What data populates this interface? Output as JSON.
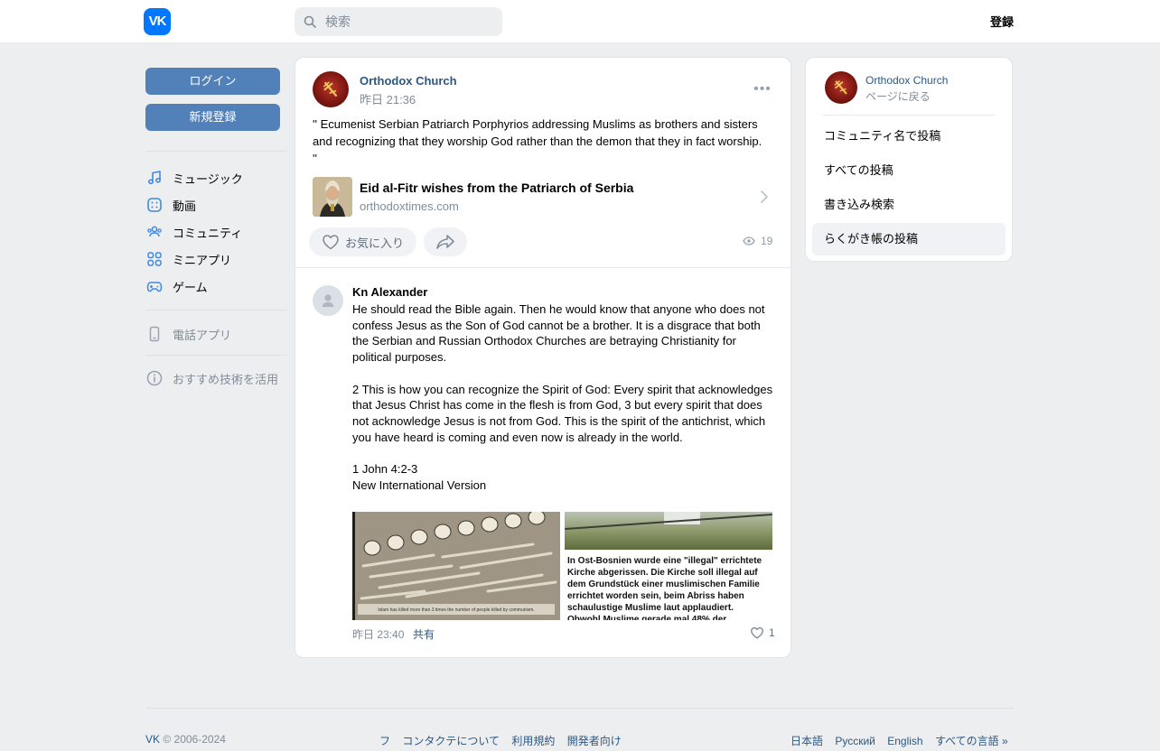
{
  "header": {
    "logo_text": "VK",
    "search_placeholder": "検索",
    "register_label": "登録"
  },
  "sidebar": {
    "login_label": "ログイン",
    "signup_label": "新規登録",
    "items": [
      {
        "label": "ミュージック",
        "icon": "music-icon"
      },
      {
        "label": "動画",
        "icon": "video-icon"
      },
      {
        "label": "コミュニティ",
        "icon": "community-icon"
      },
      {
        "label": "ミニアプリ",
        "icon": "mini-apps-icon"
      },
      {
        "label": "ゲーム",
        "icon": "gamepad-icon"
      }
    ],
    "phone_app_label": "電話アプリ",
    "recommend_label": "おすすめ技術を活用"
  },
  "post": {
    "author": "Orthodox Church",
    "time": "昨日 21:36",
    "text": "'' Ecumenist Serbian Patriarch Porphyrios addressing Muslims as brothers and sisters and recognizing that they worship God rather than the demon that they in fact worship. ''",
    "link_title": "Eid al-Fitr wishes from the Patriarch of Serbia",
    "link_domain": "orthodoxtimes.com",
    "like_label": "お気に入り",
    "views": "19"
  },
  "comment": {
    "author": "Kn Alexander",
    "paragraphs": [
      "He should read the Bible again. Then he would know that anyone who does not confess Jesus as the Son of God cannot be a brother. It is a disgrace that both the Serbian and Russian Orthodox Churches are betraying Christianity for political purposes.",
      "2 This is how you can recognize the Spirit of God: Every spirit that acknowledges that Jesus Christ has come in the flesh is from God, 3 but every spirit that does not acknowledge Jesus is not from God. This is the spirit of the antichrist, which you have heard is coming and even now is already in the world.",
      "1 John 4:2-3\nNew International Version"
    ],
    "image1_caption": "Islam has killed more than 3 times the number of people killed by communism.",
    "image2_caption": "In Ost-Bosnien wurde eine \"illegal\" errichtete Kirche abgerissen. Die Kirche soll illegal auf dem Grundstück einer muslimischen Familie errichtet worden sein, beim Abriss haben schaulustige Muslime laut applaudiert. Obwohl Muslime gerade mal 48% der",
    "time": "昨日 23:40",
    "share_label": "共有",
    "likes": "1"
  },
  "right_column": {
    "name": "Orthodox Church",
    "back_label": "ページに戻る",
    "items": [
      {
        "label": "コミュニティ名で投稿",
        "active": false
      },
      {
        "label": "すべての投稿",
        "active": false
      },
      {
        "label": "書き込み検索",
        "active": false
      },
      {
        "label": "らくがき帳の投稿",
        "active": true
      }
    ]
  },
  "footer": {
    "copyright_brand": "VK",
    "copyright_years": "© 2006-2024",
    "links": [
      "フ",
      "コンタクテについて",
      "利用規約",
      "開発者向け"
    ],
    "languages": [
      "日本語",
      "Русский",
      "English",
      "すべての言語 »"
    ]
  },
  "colors": {
    "brand_blue": "#0077ff",
    "button_blue": "#5181b8",
    "link_blue": "#2a5885",
    "muted_gray": "#818c99",
    "background": "#edeef0"
  }
}
